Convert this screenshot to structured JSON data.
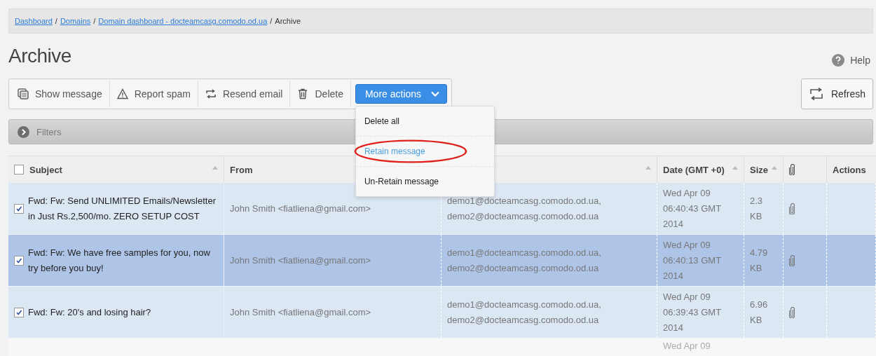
{
  "breadcrumb": {
    "links": [
      "Dashboard",
      "Domains",
      "Domain dashboard - docteamcasg.comodo.od.ua"
    ],
    "separators": [
      "/",
      "/",
      "/"
    ],
    "current": "Archive"
  },
  "title": "Archive",
  "help": "Help",
  "toolbar": [
    {
      "label": "Show message"
    },
    {
      "label": "Report spam"
    },
    {
      "label": "Resend email"
    },
    {
      "label": "Delete"
    }
  ],
  "more_actions": {
    "label": "More actions",
    "expanded": true,
    "items": [
      {
        "label": "Delete all",
        "selected": false,
        "highlighted": false
      },
      {
        "label": "Retain message",
        "selected": true,
        "highlighted": true
      },
      {
        "label": "Un-Retain message",
        "selected": false,
        "highlighted": false
      }
    ]
  },
  "refresh": "Refresh",
  "filters": {
    "label": "Filters",
    "expanded": false
  },
  "table": {
    "select_all": {
      "checked": false
    },
    "columns": [
      {
        "label": "Subject",
        "sortable": true
      },
      {
        "label": "From"
      },
      {
        "sortable": true
      },
      {
        "label": "Date (GMT +0)",
        "sortable": true
      },
      {
        "label": "Size",
        "sortable": true
      },
      {
        "kind": "attachment"
      },
      {
        "label": "Actions"
      }
    ],
    "rows": [
      {
        "checked": true,
        "selected": false,
        "subject": "Fwd: Fw: Send UNLIMITED Emails/Newsletter in Just Rs.2,500/mo. ZERO SETUP COST",
        "from": "John Smith <fiatliena@gmail.com>",
        "to": [
          "demo1@docteamcasg.comodo.od.ua,",
          "demo2@docteamcasg.comodo.od.ua"
        ],
        "date": [
          "Wed Apr 09",
          "06:40:43 GMT",
          "2014"
        ],
        "size": "2.3 KB",
        "attachment": true
      },
      {
        "checked": true,
        "selected": true,
        "subject": "Fwd: Fw: We have free samples for you, now try before you buy!",
        "from": "John Smith <fiatliena@gmail.com>",
        "to": [
          "demo1@docteamcasg.comodo.od.ua,",
          "demo2@docteamcasg.comodo.od.ua"
        ],
        "date": [
          "Wed Apr 09",
          "06:40:13 GMT",
          "2014"
        ],
        "size": "4.79 KB",
        "attachment": true
      },
      {
        "checked": true,
        "selected": false,
        "subject": "Fwd: Fw: 20's and losing hair?",
        "from": "John Smith <fiatliena@gmail.com>",
        "to": [
          "demo1@docteamcasg.comodo.od.ua,",
          "demo2@docteamcasg.comodo.od.ua"
        ],
        "date": [
          "Wed Apr 09",
          "06:39:43 GMT",
          "2014"
        ],
        "size": "6.96 KB",
        "attachment": true
      }
    ],
    "partial_row_date": "Wed Apr 09"
  }
}
